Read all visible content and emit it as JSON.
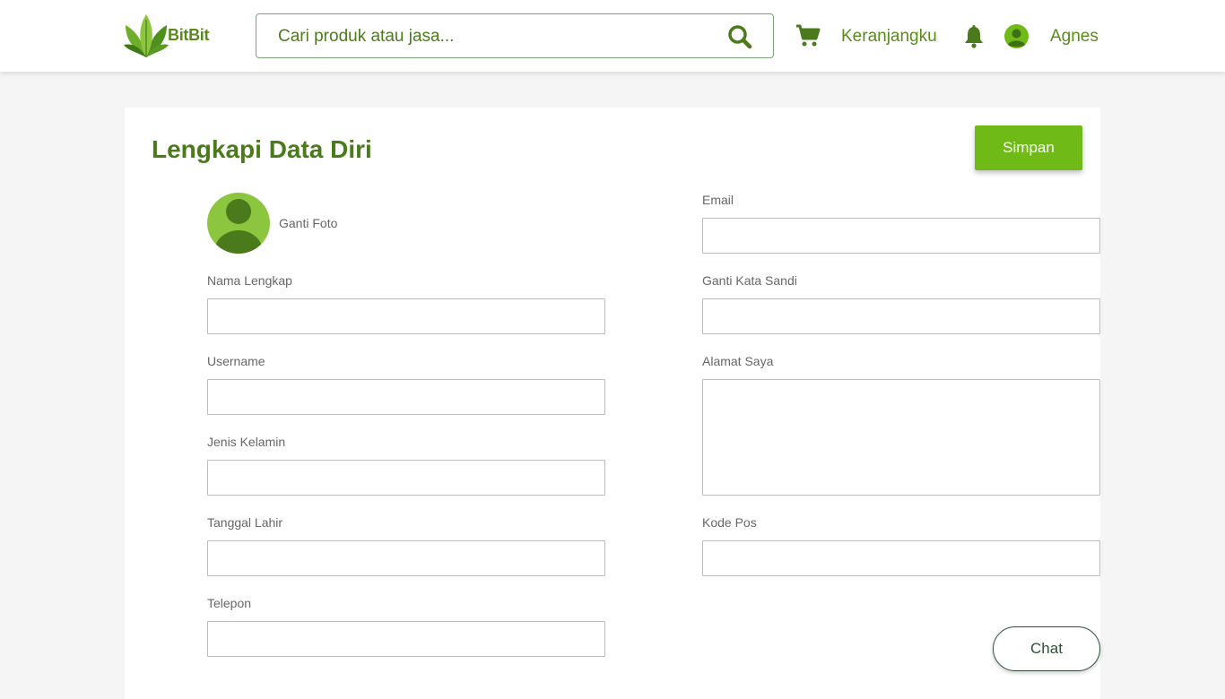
{
  "header": {
    "brand": "BitBit",
    "search_placeholder": "Cari produk atau jasa...",
    "cart_label": "Keranjangku",
    "user_name": "Agnes",
    "icons": [
      "logo-leaf-icon",
      "search-icon",
      "cart-icon",
      "bell-icon",
      "user-avatar-icon"
    ]
  },
  "profile_form": {
    "title": "Lengkapi Data Diri",
    "save_label": "Simpan",
    "change_photo_label": "Ganti Foto",
    "left_fields": [
      {
        "label": "Nama Lengkap",
        "value": ""
      },
      {
        "label": "Username",
        "value": ""
      },
      {
        "label": "Jenis Kelamin",
        "value": ""
      },
      {
        "label": "Tanggal Lahir",
        "value": ""
      },
      {
        "label": "Telepon",
        "value": ""
      }
    ],
    "right_fields": [
      {
        "label": "Email",
        "value": ""
      },
      {
        "label": "Ganti Kata Sandi",
        "value": ""
      },
      {
        "label": "Alamat Saya",
        "value": ""
      },
      {
        "label": "Kode Pos",
        "value": ""
      }
    ]
  },
  "chat_label": "Chat",
  "colors": {
    "brand_green": "#5a8a1c",
    "button_green": "#6fba17",
    "avatar_green": "#8cc63f",
    "title_green": "#4a7a1c"
  }
}
